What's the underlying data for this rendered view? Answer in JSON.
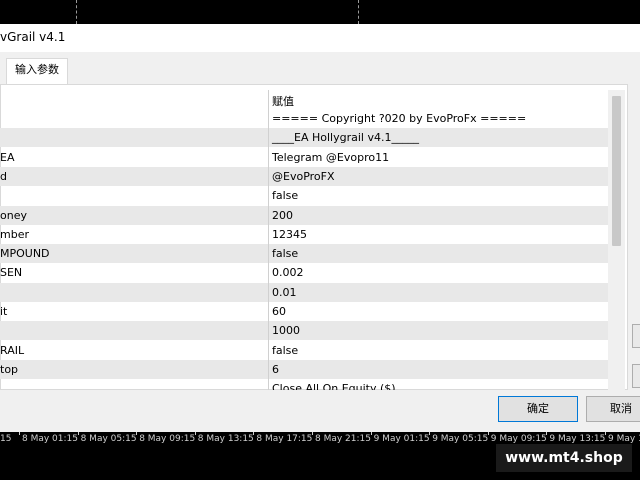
{
  "window": {
    "title": "vGrail v4.1",
    "tab_label": "输入参数"
  },
  "params": {
    "header_value": "赋值",
    "rows": [
      {
        "name": "",
        "value": "===== Copyright ?020 by EvoProFx ====="
      },
      {
        "name": "",
        "value": "____EA Hollygrail v4.1_____"
      },
      {
        "name": "EA",
        "value": "Telegram @Evopro11"
      },
      {
        "name": "d",
        "value": "@EvoProFX"
      },
      {
        "name": "",
        "value": "false"
      },
      {
        "name": "oney",
        "value": "200"
      },
      {
        "name": "mber",
        "value": "12345"
      },
      {
        "name": "MPOUND",
        "value": "false"
      },
      {
        "name": "SEN",
        "value": "0.002"
      },
      {
        "name": "",
        "value": "0.01"
      },
      {
        "name": "it",
        "value": "60"
      },
      {
        "name": "",
        "value": "1000"
      },
      {
        "name": "RAIL",
        "value": "false"
      },
      {
        "name": "top",
        "value": "6"
      },
      {
        "name": "",
        "value": "Close All On Equity ($)"
      }
    ]
  },
  "buttons": {
    "ok": "确定",
    "cancel": "取消"
  },
  "timeaxis": [
    "8 May 01:15",
    "8 May 05:15",
    "8 May 09:15",
    "8 May 13:15",
    "8 May 17:15",
    "8 May 21:15",
    "9 May 01:15",
    "9 May 05:15",
    "9 May 09:15",
    "9 May 13:15",
    "9 May 17:15"
  ],
  "timeaxis_left": "15",
  "watermark": "www.mt4.shop"
}
